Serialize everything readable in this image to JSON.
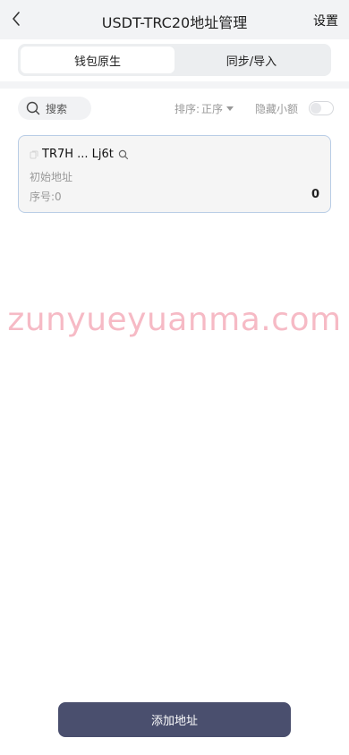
{
  "header": {
    "title": "USDT-TRC20地址管理",
    "settings_label": "设置"
  },
  "tabs": [
    {
      "label": "钱包原生",
      "active": true
    },
    {
      "label": "同步/导入",
      "active": false
    }
  ],
  "toolbar": {
    "search_placeholder": "搜索",
    "sort_label": "排序:",
    "sort_value": "正序",
    "hide_small_label": "隐藏小额",
    "hide_small_on": false
  },
  "addresses": [
    {
      "address": "TR7H ... Lj6t",
      "name": "初始地址",
      "index_label": "序号:0",
      "balance": "0"
    }
  ],
  "watermark": "zunyueyuanma.com",
  "add_button_label": "添加地址",
  "colors": {
    "accent": "#4a4f6e",
    "card_border": "#b9cde6"
  }
}
